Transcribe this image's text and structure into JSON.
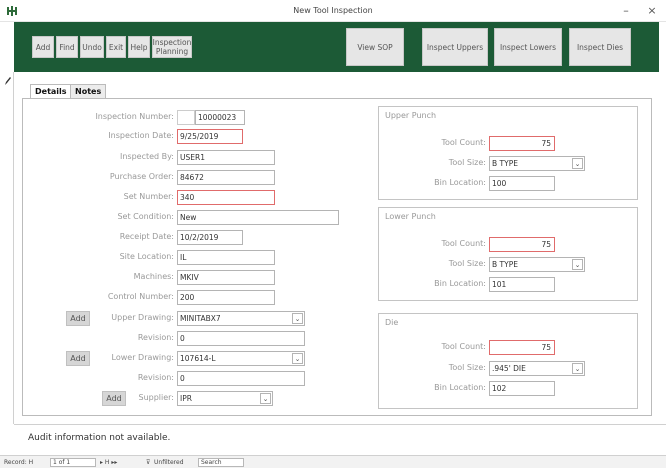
{
  "window": {
    "title": "New Tool Inspection",
    "minimize_glyph": "–",
    "close_glyph": "×",
    "app_icon": "app-icon"
  },
  "toolbar": {
    "add": "Add",
    "find": "Find",
    "undo": "Undo",
    "exit": "Exit",
    "help": "Help",
    "inspection_planning": "Inspection Planning",
    "view_sop": "View SOP",
    "inspect_uppers": "Inspect Uppers",
    "inspect_lowers": "Inspect Lowers",
    "inspect_dies": "Inspect Dies",
    "background_color": "#1c5a36"
  },
  "tabs": {
    "details": "Details",
    "notes": "Notes"
  },
  "form": {
    "inspection_number": {
      "label": "Inspection Number:",
      "value": "10000023"
    },
    "inspection_date": {
      "label": "Inspection Date:",
      "value": "9/25/2019"
    },
    "inspected_by": {
      "label": "Inspected By:",
      "value": "USER1"
    },
    "purchase_order": {
      "label": "Purchase Order:",
      "value": "84672"
    },
    "set_number": {
      "label": "Set Number:",
      "value": "340"
    },
    "set_condition": {
      "label": "Set Condition:",
      "value": "New"
    },
    "receipt_date": {
      "label": "Receipt Date:",
      "value": "10/2/2019"
    },
    "site_location": {
      "label": "Site Location:",
      "value": "IL"
    },
    "machines": {
      "label": "Machines:",
      "value": "MKIV"
    },
    "control_number": {
      "label": "Control Number:",
      "value": "200"
    },
    "upper_drawing": {
      "add": "Add",
      "label": "Upper Drawing:",
      "value": "MINITABX7"
    },
    "upper_revision": {
      "label": "Revision:",
      "value": "0"
    },
    "lower_drawing": {
      "add": "Add",
      "label": "Lower Drawing:",
      "value": "107614-L"
    },
    "lower_revision": {
      "label": "Revision:",
      "value": "0"
    },
    "supplier": {
      "add": "Add",
      "label": "Supplier:",
      "value": "IPR"
    }
  },
  "upper_punch": {
    "title": "Upper Punch",
    "tool_count_label": "Tool Count:",
    "tool_count": "75",
    "tool_size_label": "Tool Size:",
    "tool_size": "B TYPE",
    "bin_location_label": "Bin Location:",
    "bin_location": "100"
  },
  "lower_punch": {
    "title": "Lower Punch",
    "tool_count_label": "Tool Count:",
    "tool_count": "75",
    "tool_size_label": "Tool Size:",
    "tool_size": "B TYPE",
    "bin_location_label": "Bin Location:",
    "bin_location": "101"
  },
  "die": {
    "title": "Die",
    "tool_count_label": "Tool Count:",
    "tool_count": "75",
    "tool_size_label": "Tool Size:",
    "tool_size": ".945' DIE",
    "bin_location_label": "Bin Location:",
    "bin_location": "102"
  },
  "audit": {
    "text": "Audit information not available."
  },
  "status": {
    "record_label": "Record: H",
    "record_pos": "1 of 1",
    "nav": "▸ H ▸▸",
    "filter": "Unfiltered",
    "search": "Search"
  },
  "colors": {
    "required_border": "#e06b6b",
    "toolbar_green": "#1c5a36"
  }
}
